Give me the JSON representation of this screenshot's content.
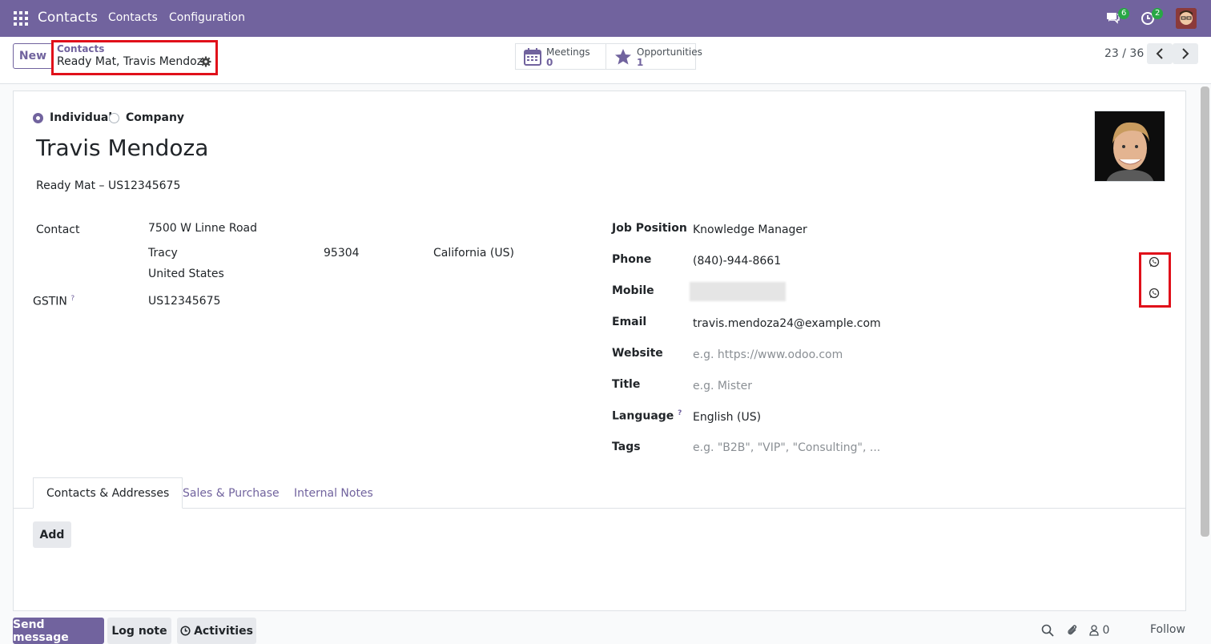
{
  "navbar": {
    "brand": "Contacts",
    "menu": [
      "Contacts",
      "Configuration"
    ],
    "messages_badge": "6",
    "activities_badge": "2"
  },
  "control_panel": {
    "new_label": "New",
    "breadcrumb_parent": "Contacts",
    "breadcrumb_current": "Ready Mat, Travis Mendoza",
    "smart_buttons": [
      {
        "label": "Meetings",
        "value": "0",
        "icon": "calendar-icon"
      },
      {
        "label": "Opportunities",
        "value": "1",
        "icon": "star-icon"
      }
    ],
    "pager": "23 / 36"
  },
  "form": {
    "type_options": [
      {
        "label": "Individual",
        "checked": true
      },
      {
        "label": "Company",
        "checked": false
      }
    ],
    "name": "Travis Mendoza",
    "company_line": "Ready Mat – US12345675",
    "contact_label": "Contact",
    "street": "7500 W Linne Road",
    "city": "Tracy",
    "zip": "95304",
    "state": "California (US)",
    "country": "United States",
    "gstin_label": "GSTIN",
    "gstin_value": "US12345675",
    "help_mark": "?",
    "right_fields": {
      "job_position_label": "Job Position",
      "job_position_value": "Knowledge Manager",
      "phone_label": "Phone",
      "phone_value": "(840)-944-8661",
      "mobile_label": "Mobile",
      "email_label": "Email",
      "email_value": "travis.mendoza24@example.com",
      "website_label": "Website",
      "website_placeholder": "e.g. https://www.odoo.com",
      "title_label": "Title",
      "title_placeholder": "e.g. Mister",
      "language_label": "Language",
      "language_value": "English (US)",
      "tags_label": "Tags",
      "tags_placeholder": "e.g. \"B2B\", \"VIP\", \"Consulting\", ..."
    }
  },
  "tabs": [
    "Contacts & Addresses",
    "Sales & Purchase",
    "Internal Notes"
  ],
  "add_label": "Add",
  "chatter": {
    "send_message": "Send message",
    "log_note": "Log note",
    "activities": "Activities",
    "followers_count": "0",
    "follow": "Follow"
  },
  "colors": {
    "brand": "#71639e",
    "highlight": "#e0101a",
    "badge": "#28a745"
  }
}
